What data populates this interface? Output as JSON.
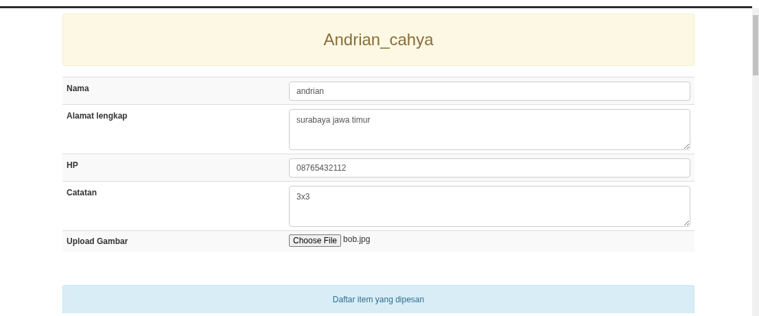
{
  "header": {
    "title": "Andrian_cahya"
  },
  "form_rows": [
    {
      "kind": "input",
      "label": "Nama",
      "value": "andrian"
    },
    {
      "kind": "textarea",
      "label": "Alamat lengkap",
      "value": "surabaya jawa timur"
    },
    {
      "kind": "input",
      "label": "HP",
      "value": "08765432112"
    },
    {
      "kind": "textarea",
      "label": "Catatan",
      "value": "3x3"
    },
    {
      "kind": "file",
      "label": "Upload Gambar",
      "button": "Choose File",
      "value": "bob.jpg"
    }
  ],
  "info_panel": {
    "text": "Daftar item yang dipesan"
  }
}
